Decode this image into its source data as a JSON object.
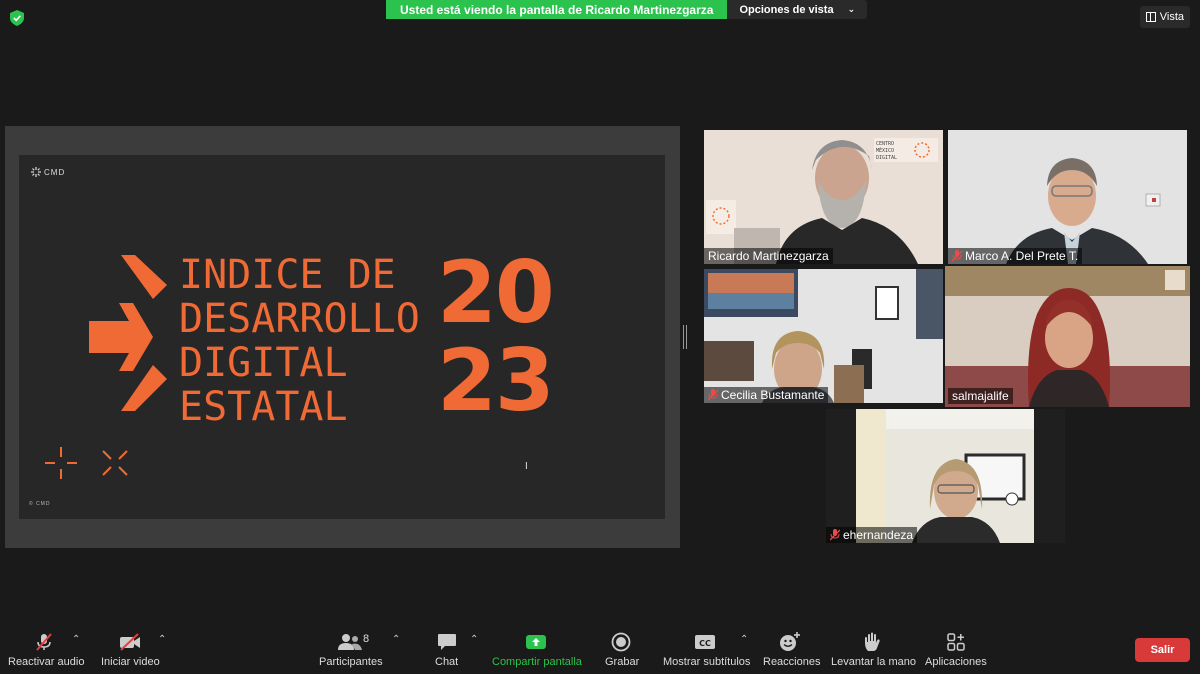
{
  "top": {
    "share_text": "Usted está viendo la pantalla de Ricardo Martinezgarza",
    "view_options": "Opciones de vista",
    "vista": "Vista"
  },
  "slide": {
    "logo": "CMD",
    "copyright": "© CMD",
    "title_lines": [
      "INDICE DE",
      "DESARROLLO",
      "DIGITAL",
      "ESTATAL"
    ],
    "year_lines": [
      "20",
      "23"
    ],
    "cursor": "I",
    "accent_color": "#f06a35"
  },
  "participants": [
    {
      "name": "Ricardo Martinezgarza",
      "muted": false
    },
    {
      "name": "Marco A. Del Prete T.",
      "muted": true
    },
    {
      "name": "Cecilia Bustamante",
      "muted": true
    },
    {
      "name": "salmajalife",
      "muted": false,
      "active_speaker": true
    },
    {
      "name": "ehernandeza",
      "muted": true
    }
  ],
  "toolbar": {
    "audio": "Reactivar audio",
    "video": "Iniciar video",
    "participants": "Participantes",
    "participants_count": "8",
    "chat": "Chat",
    "share": "Compartir pantalla",
    "record": "Grabar",
    "subtitles": "Mostrar subtítulos",
    "reactions": "Reacciones",
    "raise_hand": "Levantar la mano",
    "apps": "Aplicaciones",
    "leave": "Salir",
    "share_color": "#2bc24d",
    "leave_color": "#d83a3a"
  }
}
